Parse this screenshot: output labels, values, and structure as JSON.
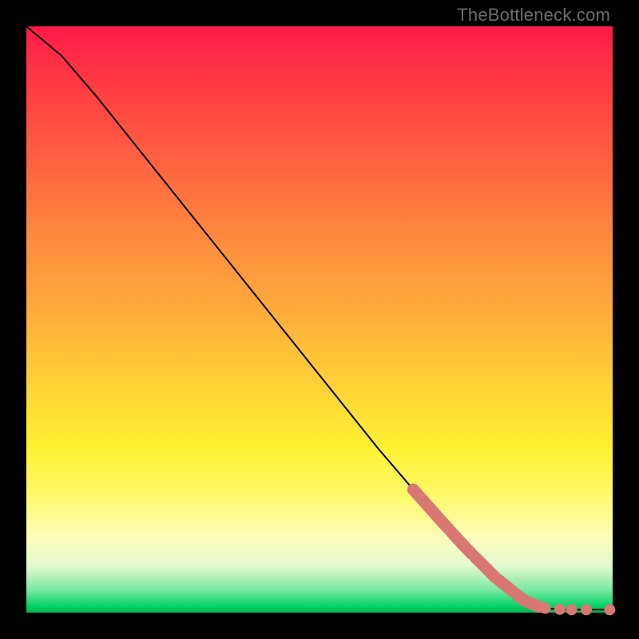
{
  "watermark": "TheBottleneck.com",
  "colors": {
    "marker": "#d97873",
    "curve": "#000000",
    "background_black": "#000000"
  },
  "chart_data": {
    "type": "line",
    "title": "",
    "xlabel": "",
    "ylabel": "",
    "xlim": [
      0,
      100
    ],
    "ylim": [
      0,
      100
    ],
    "grid": false,
    "legend": false,
    "note": "Axes have no tick labels; values are read as percentage of plot area (0–100) from the curve shape.",
    "curve_points": [
      {
        "x": 0,
        "y": 100
      },
      {
        "x": 6,
        "y": 95
      },
      {
        "x": 12,
        "y": 88
      },
      {
        "x": 20,
        "y": 78
      },
      {
        "x": 30,
        "y": 65.5
      },
      {
        "x": 40,
        "y": 53
      },
      {
        "x": 50,
        "y": 40.5
      },
      {
        "x": 60,
        "y": 28
      },
      {
        "x": 66,
        "y": 21
      },
      {
        "x": 70,
        "y": 16.5
      },
      {
        "x": 75,
        "y": 11
      },
      {
        "x": 80,
        "y": 6
      },
      {
        "x": 85,
        "y": 2
      },
      {
        "x": 88,
        "y": 0.8
      },
      {
        "x": 92,
        "y": 0.5
      },
      {
        "x": 96,
        "y": 0.5
      },
      {
        "x": 100,
        "y": 0.5
      }
    ],
    "highlighted_segments_x": [
      [
        66,
        72
      ],
      [
        72.5,
        76
      ],
      [
        76.5,
        80
      ],
      [
        80.5,
        83
      ],
      [
        83.5,
        87.5
      ]
    ],
    "tail_markers_x": [
      88.5,
      91,
      93,
      95.5,
      99.5
    ]
  }
}
